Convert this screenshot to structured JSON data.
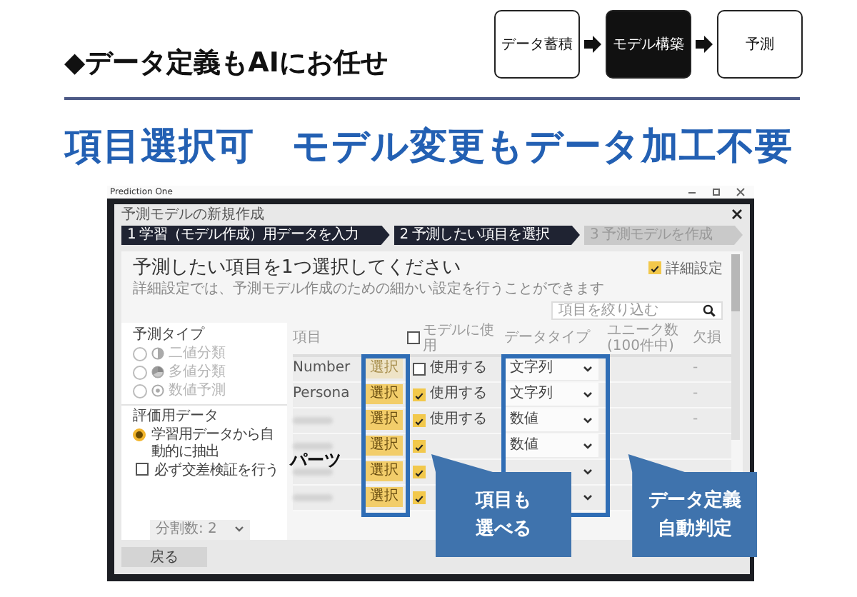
{
  "heading": "◆データ定義もAIにお任せ",
  "flow_steps": [
    {
      "label": "データ蓄積",
      "selected": false
    },
    {
      "label": "モデル構築",
      "selected": true
    },
    {
      "label": "予測",
      "selected": false
    }
  ],
  "tagline": "項目選択可　モデル変更もデータ加工不要",
  "app": {
    "title": "Prediction One",
    "dialog_title": "予測モデルの新規作成",
    "steps": [
      {
        "label": "1 学習（モデル作成）用データを入力",
        "active": true
      },
      {
        "label": "2 予測したい項目を選択",
        "active": true
      },
      {
        "label": "3 予測モデルを作成",
        "active": false
      }
    ],
    "prompt": "予測したい項目を1つ選択してください",
    "description": "詳細設定では、予測モデル作成のための細かい設定を行うことができます",
    "advanced": {
      "label": "詳細設定",
      "checked": true
    },
    "search": {
      "placeholder": "項目を絞り込む"
    },
    "prediction_type": {
      "label": "予測タイプ",
      "options": [
        {
          "label": "二値分類",
          "kind": "binary",
          "selected": false,
          "disabled": true
        },
        {
          "label": "多値分類",
          "kind": "multiclass",
          "selected": false,
          "disabled": true
        },
        {
          "label": "数値予測",
          "kind": "numeric",
          "selected": false,
          "disabled": true
        }
      ]
    },
    "evaluation": {
      "label": "評価用データ",
      "option": {
        "label": "学習用データから自動的に抽出",
        "selected": true
      },
      "cross_validation": {
        "label": "必ず交差検証を行う",
        "checked": false
      },
      "folds": "分割数: 2"
    },
    "columns": [
      "項目",
      "モデルに使用",
      "データタイプ",
      "ユニーク数(100件中)",
      "欠損"
    ],
    "use_all": {
      "checked": false
    },
    "rows": [
      {
        "name": "Number",
        "select": "選択",
        "select_enabled": false,
        "use": false,
        "use_label": "使用する",
        "type": "文字列",
        "missing": "-"
      },
      {
        "name": "Persona",
        "select": "選択",
        "select_enabled": true,
        "use": true,
        "use_label": "使用する",
        "type": "文字列",
        "missing": "-"
      },
      {
        "blurred": true,
        "select": "選択",
        "select_enabled": true,
        "use": true,
        "use_label": "使用する",
        "type": "数値",
        "missing": "-"
      },
      {
        "blurred": true,
        "select": "選択",
        "select_enabled": true,
        "use": true,
        "type": "数値"
      },
      {
        "blurred": true,
        "select": "選択",
        "select_enabled": true,
        "use": true
      },
      {
        "blurred": true,
        "select": "選択",
        "select_enabled": true,
        "use": true
      }
    ],
    "back": "戻る"
  },
  "annotation": "パーツ",
  "callouts": [
    "項目も選べる",
    "データ定義自動判定"
  ]
}
